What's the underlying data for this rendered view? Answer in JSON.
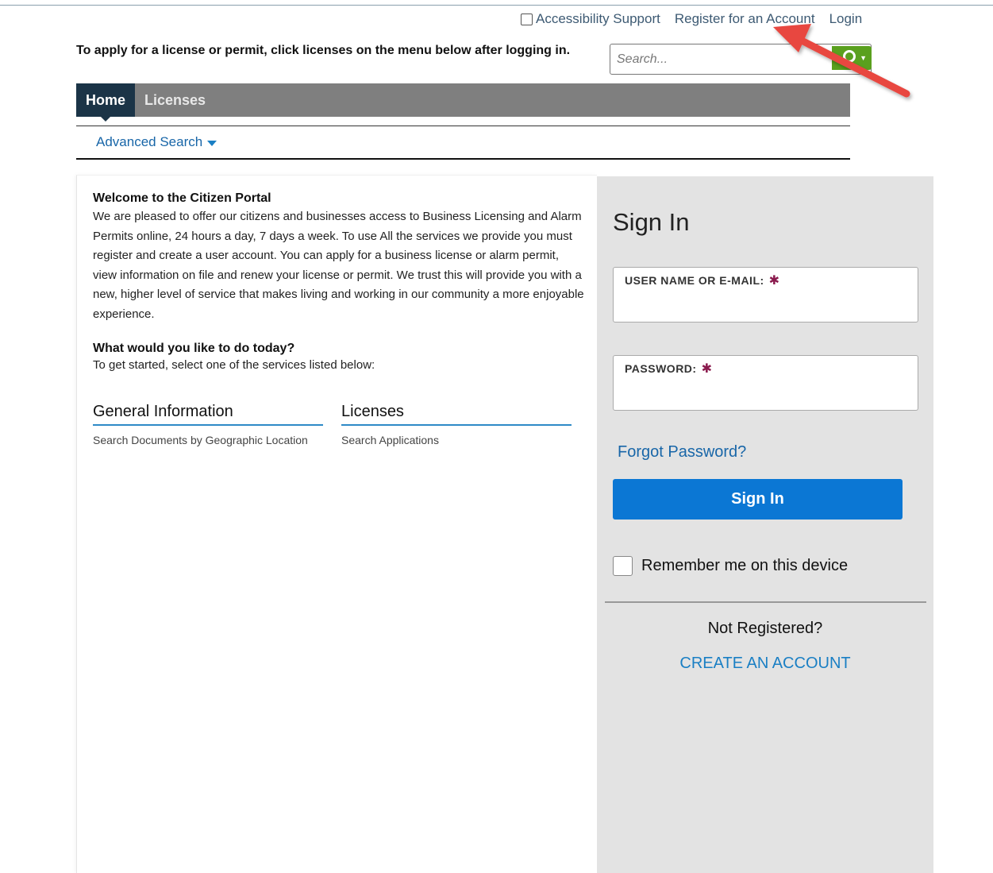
{
  "top_links": {
    "accessibility": "Accessibility Support",
    "register": "Register for an Account",
    "login": "Login"
  },
  "instruction": "To apply for a license or permit, click licenses on the menu below after logging in.",
  "search": {
    "placeholder": "Search..."
  },
  "nav": {
    "tabs": [
      "Home",
      "Licenses"
    ],
    "active": "Home"
  },
  "subnav": {
    "advanced_search": "Advanced Search"
  },
  "welcome": {
    "title": "Welcome to the Citizen Portal",
    "body": "We are pleased to offer our citizens and businesses access to Business Licensing and Alarm Permits online, 24 hours a day, 7 days a week.  To use All the services we provide you must register and create a user account.  You can apply for a business license or alarm permit, view information on file and renew your license or permit.  We trust this will provide you with a new, higher level of service that makes living and working in our community a more enjoyable experience.",
    "todo_title": "What would you like to do today?",
    "todo_body": "To get started, select one of the services listed below:"
  },
  "services": {
    "general_information": {
      "heading": "General Information",
      "link": "Search Documents by Geographic Location"
    },
    "licenses": {
      "heading": "Licenses",
      "link": "Search Applications"
    }
  },
  "signin": {
    "title": "Sign In",
    "username_label": "USER NAME OR E-MAIL:",
    "password_label": "PASSWORD:",
    "required_mark": "✱",
    "forgot": "Forgot Password?",
    "button": "Sign In",
    "remember": "Remember me on this device",
    "not_registered": "Not Registered?",
    "create_account": "CREATE AN ACCOUNT"
  },
  "colors": {
    "nav_bg": "#7f7f7f",
    "nav_active": "#1b3447",
    "link_blue": "#1866a8",
    "button_blue": "#0b77d4",
    "search_green": "#5aa01e",
    "annotation_red": "#e8473f"
  }
}
